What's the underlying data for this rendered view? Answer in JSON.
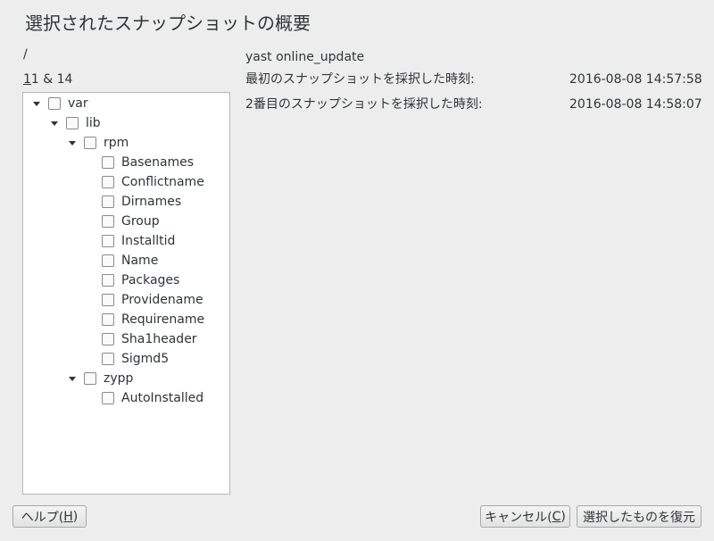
{
  "dialog": {
    "title": "選択されたスナップショットの概要",
    "path": "/",
    "range": {
      "first": "1",
      "rest": "1 & 14"
    }
  },
  "tree": {
    "nodes": [
      {
        "label": "var",
        "expanded": true
      },
      {
        "label": "lib",
        "expanded": true
      },
      {
        "label": "rpm",
        "expanded": true
      },
      {
        "label": "Basenames"
      },
      {
        "label": "Conflictname"
      },
      {
        "label": "Dirnames"
      },
      {
        "label": "Group"
      },
      {
        "label": "Installtid"
      },
      {
        "label": "Name"
      },
      {
        "label": "Packages"
      },
      {
        "label": "Providename"
      },
      {
        "label": "Requirename"
      },
      {
        "label": "Sha1header"
      },
      {
        "label": "Sigmd5"
      },
      {
        "label": "zypp",
        "expanded": true
      },
      {
        "label": "AutoInstalled"
      }
    ]
  },
  "info": {
    "description": "yast online_update",
    "first_label": "最初のスナップショットを採択した時刻:",
    "first_time": "2016-08-08 14:57:58",
    "second_label": "2番目のスナップショットを採択した時刻:",
    "second_time": "2016-08-08 14:58:07"
  },
  "buttons": {
    "help": {
      "before": "ヘルプ(",
      "mnemonic": "H",
      "after": ")"
    },
    "cancel": {
      "before": "キャンセル(",
      "mnemonic": "C",
      "after": ")"
    },
    "restore": "選択したものを復元"
  },
  "colors": {
    "background": "#ededed",
    "panel": "#ffffff",
    "text": "#2e3436"
  },
  "icons": {
    "expander": "triangle-down-icon",
    "checkbox": "checkbox-unchecked"
  }
}
